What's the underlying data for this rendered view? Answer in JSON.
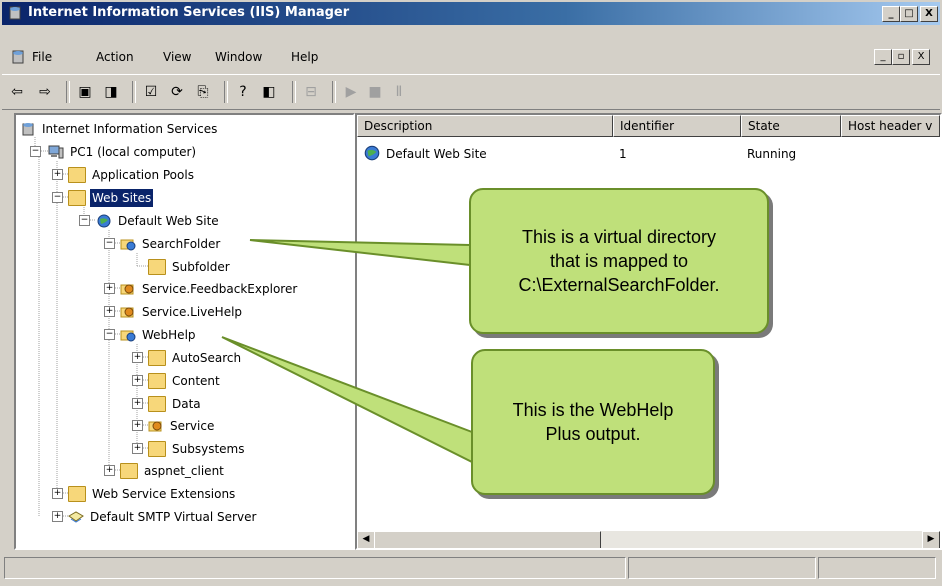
{
  "window": {
    "title": "Internet Information Services (IIS) Manager",
    "buttons": [
      "_",
      "□",
      "X"
    ]
  },
  "menu": {
    "items": [
      {
        "label": "File"
      },
      {
        "label": "Action"
      },
      {
        "label": "View"
      },
      {
        "label": "Window"
      },
      {
        "label": "Help"
      }
    ],
    "mdi_buttons": [
      "_",
      "▫",
      "X"
    ]
  },
  "toolbar": {
    "buttons": [
      "back-icon",
      "forward-icon",
      "up-folder-icon",
      "show-hide-tree-icon",
      "properties-icon",
      "refresh-icon",
      "export-list-icon",
      "help-icon",
      "show-hide-action-pane-icon",
      "connect-icon",
      "start-icon",
      "stop-icon",
      "pause-icon"
    ]
  },
  "tree": {
    "nodes": [
      {
        "label": "Internet Information Services"
      },
      {
        "label": "PC1 (local computer)"
      },
      {
        "label": "Application Pools"
      },
      {
        "label": "Web Sites"
      },
      {
        "label": "Default Web Site"
      },
      {
        "label": "SearchFolder"
      },
      {
        "label": "Subfolder"
      },
      {
        "label": "Service.FeedbackExplorer"
      },
      {
        "label": "Service.LiveHelp"
      },
      {
        "label": "WebHelp"
      },
      {
        "label": "AutoSearch"
      },
      {
        "label": "Content"
      },
      {
        "label": "Data"
      },
      {
        "label": "Service"
      },
      {
        "label": "Subsystems"
      },
      {
        "label": "aspnet_client"
      },
      {
        "label": "Web Service Extensions"
      },
      {
        "label": "Default SMTP Virtual Server"
      }
    ]
  },
  "list": {
    "columns": [
      "Description",
      "Identifier",
      "State",
      "Host header v"
    ],
    "rows": [
      {
        "description": "Default Web Site",
        "identifier": "1",
        "state": "Running"
      }
    ]
  },
  "callouts": {
    "virtual_dir": {
      "line1": "This is a virtual directory",
      "line2": "that is mapped to",
      "line3": "C:\\ExternalSearchFolder."
    },
    "webhelp": {
      "line1": "This is the WebHelp",
      "line2": "Plus output."
    }
  },
  "colors": {
    "titlebar": "#0a246a",
    "callout_fill": "#bfe07a",
    "selection": "#0a246a"
  }
}
